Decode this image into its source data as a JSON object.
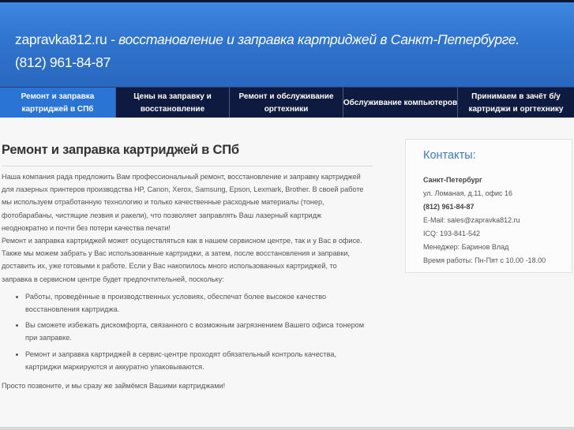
{
  "header": {
    "brand": "zapravka812.ru",
    "tagline": " - восстановление и заправка картриджей в Санкт-Петербурге.",
    "phone": "(812) 961-84-87"
  },
  "nav": {
    "items": [
      {
        "label": "Ремонт и заправка картриджей в СПб",
        "active": true
      },
      {
        "label": "Цены на заправку и восстановление",
        "active": false
      },
      {
        "label": "Ремонт и обслуживание оргтехники",
        "active": false
      },
      {
        "label": "Обслуживание компьютеров",
        "active": false
      },
      {
        "label": "Принимаем в зачёт б/у картриджи и оргтехнику",
        "active": false
      }
    ]
  },
  "main": {
    "title": "Ремонт и заправка картриджей в СПб",
    "intro": [
      "Наша компания рада предложить Вам профессиональный ремонт, восстановление и заправку картриджей",
      "для лазерных принтеров производства HP, Canon, Xerox, Samsung, Epson, Lexmark, Brother. В своей работе",
      "мы используем отработанную технологию и только качественные расходные материалы (тонер,",
      "фотобарабаны, чистящие лезвия и ракели), что позволяет заправлять Ваш лазерный картридж",
      "неоднократно и почти без потери качества печати!",
      "Ремонт и заправка картриджей может осуществляться как в нашем сервисном центре, так и у Вас в офисе.",
      "Также мы можем забрать у Вас использованные картриджи, а затем, после восстановления и заправки,",
      "доставить их, уже готовыми к работе. Если у Вас накопилось много использованных картриджей, то",
      "заправка в сервисном центре будет предпочтительней, поскольку:"
    ],
    "features": [
      [
        "Работы, проведённые в производственных условиях, обеспечат более высокое качество",
        "восстановления картриджа."
      ],
      [
        "Вы сможете избежать дискомфорта, связанного с возможным загрязнением Вашего офиса тонером",
        "при заправке."
      ],
      [
        "Ремонт и заправка картриджей в сервис-центре проходят обязательный контроль качества,",
        "картриджи маркируются и аккуратно упаковываются."
      ]
    ],
    "closing": "Просто позвоните, и мы сразу же займёмся Вашими картриджами!"
  },
  "sidebar": {
    "title": "Контакты:",
    "city": "Санкт-Петербург",
    "address": "ул. Ломаная, д.11, офис 16",
    "phone": "(812) 961-84-87",
    "email": "E-Mail: sales@zapravka812.ru",
    "icq": "ICQ: 193-841-542",
    "manager": "Менеджер: Баринов Влад",
    "hours": "Время работы: Пн-Пят с 10.00 -18.00"
  },
  "colors": {
    "header_bg": "#2f74cf",
    "nav_bg": "#0e1a3f",
    "nav_active": "#2a74d5",
    "accent": "#3a78cc"
  }
}
